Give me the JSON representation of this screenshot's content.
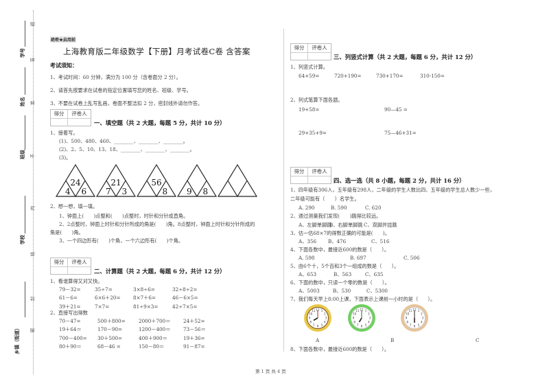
{
  "binding_strip": {
    "labels": [
      "学号",
      "姓名",
      "班级",
      "学校",
      "乡镇（街道）"
    ],
    "seal_chars": [
      "题",
      "答",
      "准",
      "不",
      "内",
      "线",
      "封",
      "密"
    ]
  },
  "header": {
    "secret_mark": "绝密★启用前",
    "title": "上海教育版二年级数学【下册】月考试卷C卷 含答案"
  },
  "notice": {
    "heading": "考试须知：",
    "items": [
      "1、考试时间：60 分钟，满分为 100 分（含卷面分 2 分）。",
      "2、请首先按要求在试卷的指定位置填写您的姓名、班级、学号。",
      "3、不要在试卷上乱写乱画，卷面不整洁扣 2 分，密封线外请勿作答。"
    ]
  },
  "score_box": {
    "score_label": "得分",
    "grader_label": "评卷人"
  },
  "section1": {
    "title": "一、填空题（共 2 大题，每题 5 分，共计 10 分）",
    "q1": {
      "stem": "1、接着写。",
      "lines": [
        "(1)、500、480、460、________、________、________。",
        "(2)、2、5、10、13、18、________、________、________。",
        "(3)。"
      ],
      "triangles": [
        {
          "top": "24",
          "left": "4",
          "right": "6"
        },
        {
          "top": "21",
          "left": "7",
          "right": "3"
        },
        {
          "top": "56",
          "left": "",
          "right": "8"
        },
        {
          "top": "",
          "left": "9",
          "right": "8"
        },
        {
          "top": "",
          "left": "",
          "right": ""
        }
      ]
    },
    "q2": {
      "stem": "2、想一想，填一填。",
      "lines": [
        "1、钟面上(　　)点整和(　　)点整时，时针和分针成直角。",
        "2、2点整时，钟面上时针和分针所成的角是(　　)角。8点整时，钟面上时针和分针所成的",
        "角是(　　)角。",
        "3、一个四边形有(　　)个角，一个六边形有(　　)个角。"
      ]
    }
  },
  "section2": {
    "title": "二、计算题（共 2 大题，每题 6 分，共计 12 分）",
    "q1": {
      "stem": "1、看谁算得又对又快。",
      "rows": [
        [
          "79－32=",
          "35÷7=",
          "3×8÷6=",
          "32÷8÷2="
        ],
        [
          "61－6=",
          "6×6＋20=",
          "8×7＋6=",
          "46－6×5="
        ],
        [
          "39＋21=",
          "7×7=",
          "81÷9×3=",
          "42÷7×5="
        ]
      ]
    },
    "q2": {
      "stem": "2、直接写出得数",
      "rows": [
        [
          "70－47=",
          "500＋800=",
          "2000＋700＝",
          "24＋52="
        ],
        [
          "19＋64＝",
          "170－90=",
          "1200－400＝",
          "73－56＝"
        ],
        [
          "700－400=",
          "30＋500=",
          "400＋900＝",
          "19＋36="
        ],
        [
          "80＋90＝",
          "68－46 =",
          "150－80＝",
          "91－87="
        ]
      ]
    }
  },
  "section3": {
    "title": "三、列竖式计算（共 2 大题，每题 6 分，共计 12 分）",
    "q1": {
      "stem": "1、列竖式计算。",
      "items": [
        "64+59=",
        "720+190=",
        "730+170=",
        "310-150="
      ]
    },
    "q2": {
      "stem": "2、列式笔算下面各题。",
      "items": [
        "19+58=",
        "90—45 =",
        "29+35+9=",
        "75—46+31="
      ]
    }
  },
  "section4": {
    "title": "四、选一选（共 8 小题，每题 2 分，共计 16 分）",
    "questions": [
      {
        "stem": [
          "1、四年级有306人，五年级有298人，二年级的学生人数比四、五年级的学生总人数少一些，",
          "二年级可能有（　　）名学生。"
        ],
        "options": [
          "A. 290",
          "B. 590",
          "C. 620"
        ]
      },
      {
        "stem": [
          "2、通过测量我们发现(　　)跳得比较远。"
        ],
        "options": [
          "A、左脚单脚跳",
          "B、右脚单脚跳",
          "C、双脚并拢跳"
        ]
      },
      {
        "stem": [
          "3、估一估68×7的得数正确的可能是(　　)。"
        ],
        "options": [
          "A、356",
          "B、476",
          "C、516"
        ]
      },
      {
        "stem": [
          "4、下面各数中，最接近600的数是（　　）。"
        ],
        "options": [
          "A. 598",
          "B. 697",
          "C. 506"
        ]
      },
      {
        "stem": [
          "5、由6个十，5个百和3个一组成的数是（　　）。"
        ],
        "options": [
          "A、653",
          "B、563",
          "C、635"
        ]
      },
      {
        "stem": [
          "6、下面的数中，只读一个零的数是（　　）。"
        ],
        "options": [
          "A、5003",
          "B、530",
          "C、5300"
        ]
      },
      {
        "stem": [
          "7、我们每天早上8:00上课，下面表示上课前一小时的是（　　）。"
        ],
        "options": [
          "A",
          "B",
          "C"
        ]
      },
      {
        "stem": [
          "8、下面各数中，最接近600的数是（　　）。"
        ],
        "options": []
      }
    ],
    "clocks": [
      {
        "label": "A",
        "hour": 8,
        "minute": 0,
        "rim": "#e8c84a",
        "hand": "#c0392b"
      },
      {
        "label": "B",
        "hour": 7,
        "minute": 0,
        "rim": "#6fcf5f",
        "hand": "#2e7d32"
      },
      {
        "label": "C",
        "hour": 6,
        "minute": 0,
        "rim": "#e7c49a",
        "hand": "#333333"
      }
    ]
  },
  "footer": {
    "page_text": "第 1 页 共 4 页"
  }
}
